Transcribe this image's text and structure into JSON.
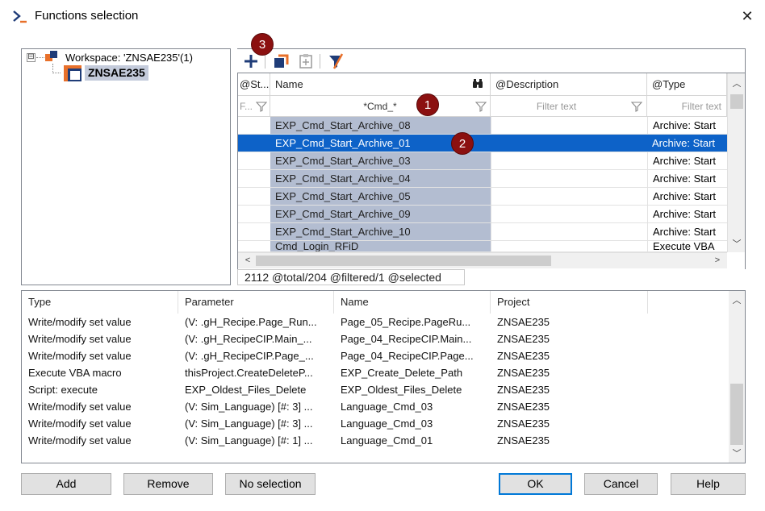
{
  "window": {
    "title": "Functions selection",
    "close_glyph": "✕"
  },
  "tree": {
    "expander_glyph": "⊟",
    "workspace_label": "Workspace: 'ZNSAE235'(1)",
    "project_label": "ZNSAE235"
  },
  "toolbar": {
    "icons": [
      "add-icon",
      "link-icon",
      "paste-icon",
      "filter-clear-icon"
    ]
  },
  "grid": {
    "headers": {
      "status": "@St...",
      "name": "Name",
      "description": "@Description",
      "type": "@Type"
    },
    "filters": {
      "status": "F...",
      "name": "*Cmd_*",
      "description": "Filter text",
      "type": "Filter text"
    },
    "rows": [
      {
        "name": "EXP_Cmd_Start_Archive_08",
        "type": "Archive: Start"
      },
      {
        "name": "EXP_Cmd_Start_Archive_01",
        "type": "Archive: Start",
        "selected": true
      },
      {
        "name": "EXP_Cmd_Start_Archive_03",
        "type": "Archive: Start"
      },
      {
        "name": "EXP_Cmd_Start_Archive_04",
        "type": "Archive: Start"
      },
      {
        "name": "EXP_Cmd_Start_Archive_05",
        "type": "Archive: Start"
      },
      {
        "name": "EXP_Cmd_Start_Archive_09",
        "type": "Archive: Start"
      },
      {
        "name": "EXP_Cmd_Start_Archive_10",
        "type": "Archive: Start"
      },
      {
        "name": "Cmd_Login_RFiD",
        "type": "Execute VBA"
      }
    ]
  },
  "status_text": "2112 @total/204 @filtered/1 @selected",
  "badges": [
    "1",
    "2",
    "3"
  ],
  "list": {
    "headers": [
      "Type",
      "Parameter",
      "Name",
      "Project"
    ],
    "rows": [
      [
        "Write/modify set value",
        "(V: .gH_Recipe.Page_Run...",
        "Page_05_Recipe.PageRu...",
        "ZNSAE235"
      ],
      [
        "Write/modify set value",
        "(V: .gH_RecipeCIP.Main_...",
        "Page_04_RecipeCIP.Main...",
        "ZNSAE235"
      ],
      [
        "Write/modify set value",
        "(V: .gH_RecipeCIP.Page_...",
        "Page_04_RecipeCIP.Page...",
        "ZNSAE235"
      ],
      [
        "Execute VBA macro",
        "thisProject.CreateDeleteP...",
        "EXP_Create_Delete_Path",
        "ZNSAE235"
      ],
      [
        "Script: execute",
        "EXP_Oldest_Files_Delete",
        "EXP_Oldest_Files_Delete",
        "ZNSAE235"
      ],
      [
        "Write/modify set value",
        "(V: Sim_Language) [#: 3] ...",
        "Language_Cmd_03",
        "ZNSAE235"
      ],
      [
        "Write/modify set value",
        "(V: Sim_Language) [#: 3] ...",
        "Language_Cmd_03",
        "ZNSAE235"
      ],
      [
        "Write/modify set value",
        "(V: Sim_Language) [#: 1] ...",
        "Language_Cmd_01",
        "ZNSAE235"
      ]
    ]
  },
  "buttons": {
    "add": "Add",
    "remove": "Remove",
    "no_selection": "No selection",
    "ok": "OK",
    "cancel": "Cancel",
    "help": "Help"
  },
  "colors": {
    "selection": "#0d62c8",
    "name_column": "#b3bdd1",
    "badge": "#8b1010",
    "accent_orange": "#e8702a",
    "dark_blue": "#1f3c78"
  }
}
